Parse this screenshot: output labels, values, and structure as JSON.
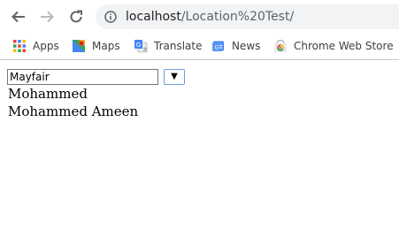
{
  "browser": {
    "url_host": "localhost",
    "url_path": "/Location%20Test/",
    "bookmarks": [
      {
        "label": "Apps",
        "icon": "apps-grid-icon"
      },
      {
        "label": "Maps",
        "icon": "maps-icon"
      },
      {
        "label": "Translate",
        "icon": "translate-icon"
      },
      {
        "label": "News",
        "icon": "news-icon"
      },
      {
        "label": "Chrome Web Store",
        "icon": "chrome-web-store-icon"
      }
    ]
  },
  "page": {
    "location_input_value": "Mayfair",
    "dropdown_button_label": "▼",
    "results": [
      "Mohammed",
      "Mohammed Ameen"
    ]
  }
}
